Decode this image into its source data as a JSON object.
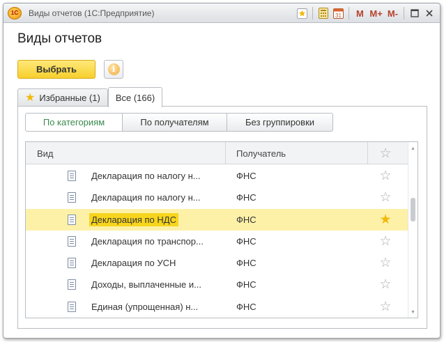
{
  "window": {
    "title": "Виды отчетов (1С:Предприятие)",
    "logo_text": "1С",
    "toolbar": {
      "m": "M",
      "m_plus": "M+",
      "m_minus": "M-",
      "calendar_num": "31"
    }
  },
  "page": {
    "heading": "Виды отчетов"
  },
  "actions": {
    "select_label": "Выбрать",
    "info_glyph": "i"
  },
  "tabs": [
    {
      "label": "Избранные (1)",
      "active": false,
      "icon": "star-icon"
    },
    {
      "label": "Все (166)",
      "active": true
    }
  ],
  "grouping": [
    {
      "label": "По категориям",
      "active": true
    },
    {
      "label": "По получателям",
      "active": false
    },
    {
      "label": "Без группировки",
      "active": false
    }
  ],
  "table": {
    "columns": {
      "kind": "Вид",
      "recipient": "Получатель"
    },
    "rows": [
      {
        "name": "Декларация по налогу н...",
        "recipient": "ФНС",
        "favorite": false,
        "selected": false
      },
      {
        "name": "Декларация по налогу н...",
        "recipient": "ФНС",
        "favorite": false,
        "selected": false
      },
      {
        "name": "Декларация по НДС",
        "recipient": "ФНС",
        "favorite": true,
        "selected": true
      },
      {
        "name": "Декларация по транспор...",
        "recipient": "ФНС",
        "favorite": false,
        "selected": false
      },
      {
        "name": "Декларация по УСН",
        "recipient": "ФНС",
        "favorite": false,
        "selected": false
      },
      {
        "name": "Доходы, выплаченные и...",
        "recipient": "ФНС",
        "favorite": false,
        "selected": false
      },
      {
        "name": "Единая (упрощенная) н...",
        "recipient": "ФНС",
        "favorite": false,
        "selected": false
      }
    ]
  },
  "colors": {
    "accent_yellow": "#f7cf2d",
    "selected_row": "#fdf1a8",
    "active_group": "#3a8a4d",
    "favorite_star": "#f2b90a"
  }
}
